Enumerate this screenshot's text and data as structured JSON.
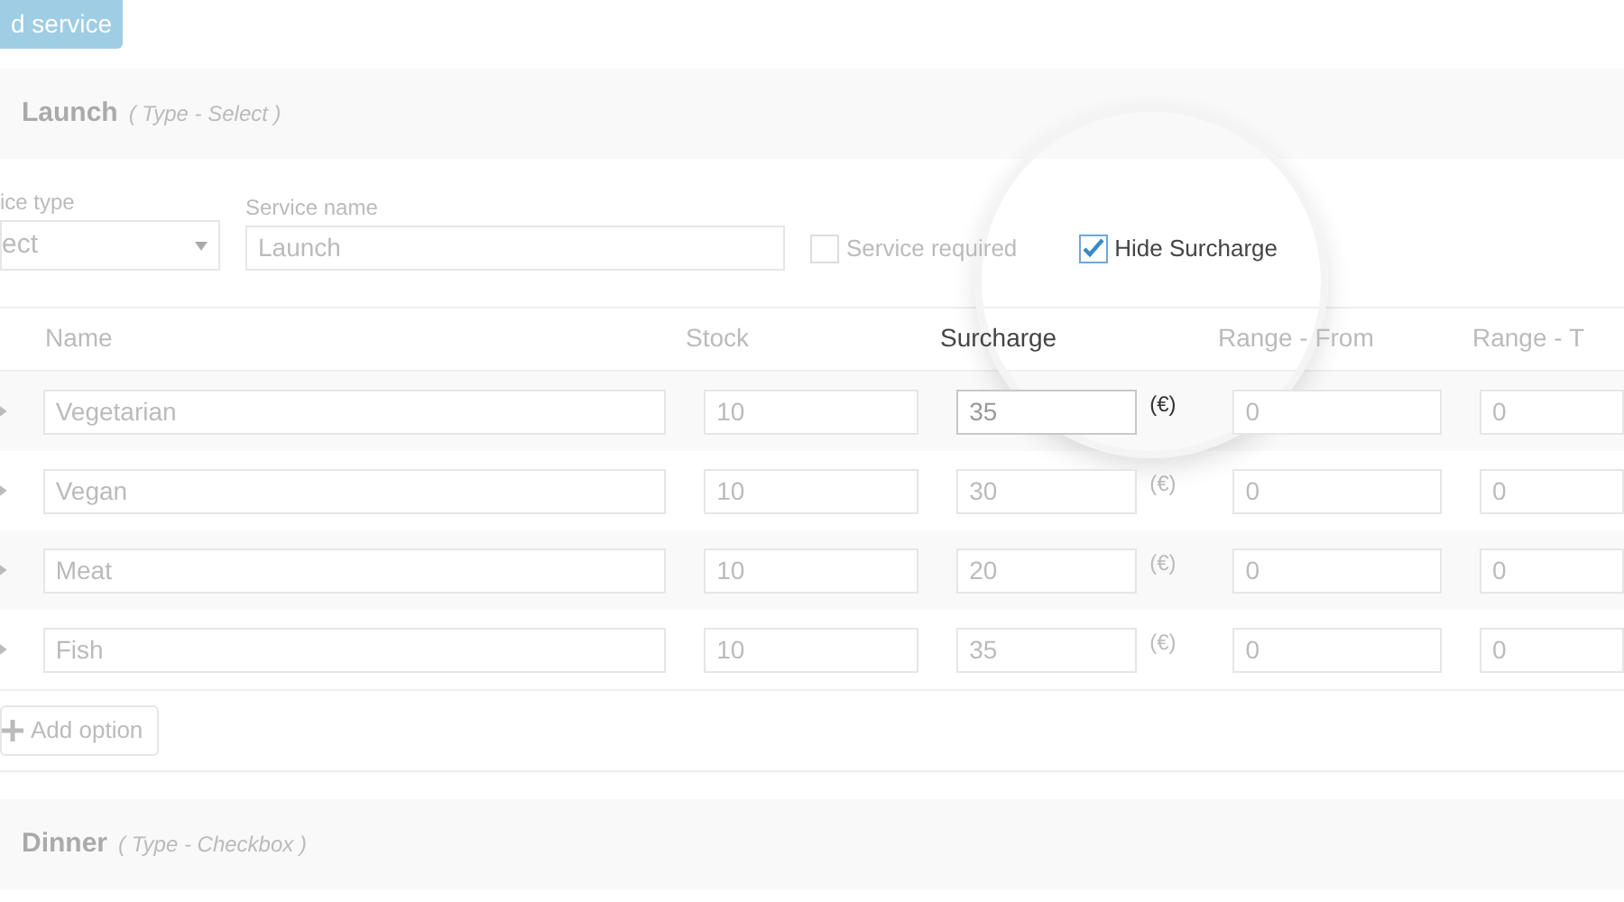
{
  "add_service_button": "d service",
  "service": {
    "title": "Launch",
    "type_note": "( Type - Select )",
    "service_type": {
      "label": "ice type",
      "value": "ect"
    },
    "service_name": {
      "label": "Service name",
      "value": "Launch"
    },
    "checkboxes": [
      {
        "label": "Service required",
        "checked": false,
        "magnified": false
      },
      {
        "label": "Hide Surcharge",
        "checked": true,
        "magnified": true
      }
    ],
    "columns": [
      {
        "label": "Name",
        "magnified": false
      },
      {
        "label": "Stock",
        "magnified": false
      },
      {
        "label": "Surcharge",
        "magnified": true
      },
      {
        "label": "Range - From",
        "magnified": false
      },
      {
        "label": "Range - T",
        "magnified": false
      }
    ],
    "rows": [
      {
        "name": "Vegetarian",
        "stock": "10",
        "surcharge": "35",
        "currency": "(€)",
        "from": "0",
        "to": "0",
        "magnified": true
      },
      {
        "name": "Vegan",
        "stock": "10",
        "surcharge": "30",
        "currency": "(€)",
        "from": "0",
        "to": "0",
        "magnified": false
      },
      {
        "name": "Meat",
        "stock": "10",
        "surcharge": "20",
        "currency": "(€)",
        "from": "0",
        "to": "0",
        "magnified": false
      },
      {
        "name": "Fish",
        "stock": "10",
        "surcharge": "35",
        "currency": "(€)",
        "from": "0",
        "to": "0",
        "magnified": false
      }
    ],
    "add_option_button": "Add option"
  },
  "next_service": {
    "title": "Dinner",
    "type_note": "( Type - Checkbox )"
  }
}
